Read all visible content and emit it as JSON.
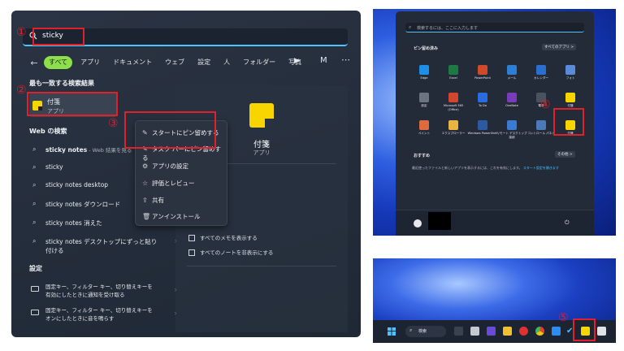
{
  "annotations": {
    "step1": "①",
    "step2": "②",
    "step3": "③",
    "step4": "④",
    "step5": "⑤",
    "color": "#e0202a"
  },
  "search": {
    "query": "sticky",
    "filters": [
      "すべて",
      "アプリ",
      "ドキュメント",
      "ウェブ",
      "設定",
      "人",
      "フォルダー",
      "写真"
    ],
    "account_letter": "M",
    "accent": "#8ee04a"
  },
  "best_match": {
    "heading": "最も一致する検索結果",
    "title": "付箋",
    "subtitle": "アプリ"
  },
  "web": {
    "heading": "Web の検索",
    "items": [
      {
        "main": "sticky notes",
        "suffix": " - Web 結果を見る"
      },
      {
        "main": "sticky",
        "suffix": ""
      },
      {
        "main": "sticky notes desktop",
        "suffix": ""
      },
      {
        "main": "sticky notes ダウンロード",
        "suffix": ""
      },
      {
        "main": "sticky notes 消えた",
        "suffix": ""
      },
      {
        "main": "sticky notes デスクトップにずっと貼り",
        "line2": "付ける"
      }
    ]
  },
  "settings_section": {
    "heading": "設定",
    "items": [
      {
        "line1": "固定キー、フィルター キー、切り替えキーを",
        "line2": "有効にしたときに通知を受け取る"
      },
      {
        "line1": "固定キー、フィルター キー、切り替えキーを",
        "line2": "オンにしたときに音を鳴らす"
      }
    ]
  },
  "context_menu": {
    "items": [
      "スタートにピン留めする",
      "タスク バーにピン留めする",
      "アプリの設定",
      "評価とレビュー",
      "共有",
      "アンインストール"
    ]
  },
  "right_pane": {
    "title": "付箋",
    "subtitle": "アプリ",
    "actions": [
      "モ",
      "覧",
      "すべてのメモを表示する",
      "すべてのノートを非表示にする"
    ]
  },
  "start_menu": {
    "search_placeholder": "検索するには、ここに入力します",
    "pinned_heading": "ピン留め済み",
    "all_apps": "すべてのアプリ >",
    "recommended_heading": "おすすめ",
    "more": "その他 >",
    "recommended_text": "最近使ったファイルと新しいアプリを表示するには、これを有効にします。",
    "recommended_link": "スタート設定を開きます",
    "apps": [
      "Edge",
      "Excel",
      "PowerPoint",
      "メール",
      "カレンダー",
      "フォト",
      "設定",
      "Microsoft 365 (Office)",
      "To Do",
      "OneNote",
      "電卓",
      "付箋",
      "ペイント",
      "エクスプローラー",
      "Windows PowerShell",
      "リモート デスクトップ接続",
      "コントロール パネル",
      "付箋"
    ]
  },
  "taskbar": {
    "search_label": "検索"
  }
}
